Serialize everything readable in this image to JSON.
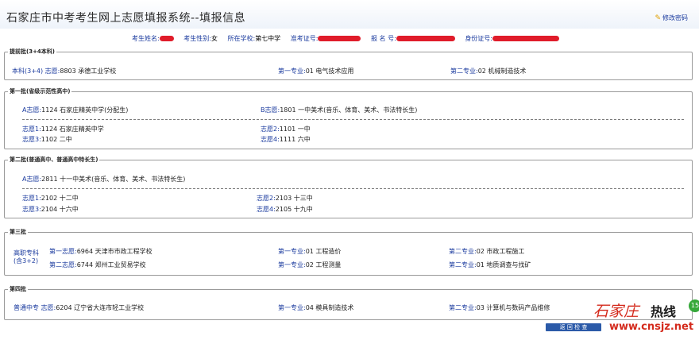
{
  "header": {
    "title": "石家庄市中考考生网上志愿填报系统--填报信息",
    "modify_password": "修改密码"
  },
  "student_info": {
    "name_label": "考生姓名:",
    "gender_label": "考生性别:",
    "gender_value": "女",
    "school_label": "所在学校:",
    "school_value": "第七中学",
    "exam_no_label": "准考证号:",
    "reg_no_label": "报 名 号:",
    "id_label": "身份证号:"
  },
  "sections": {
    "early": {
      "legend": "提前批(3+4本科)",
      "category": "本科(3+4)",
      "choice_label": "志愿:",
      "choice_value": "8803 承德工业学校",
      "major1_label": "第一专业:",
      "major1_value": "01 电气技术应用",
      "major2_label": "第二专业:",
      "major2_value": "02 机械制造技术"
    },
    "batch1": {
      "legend": "第一批(省级示范性高中)",
      "a_label": "A志愿:",
      "a_value": "1124 石家庄精英中学(分配生)",
      "b_label": "B志愿:",
      "b_value": "1801 一中美术(音乐、体育、美术、书法特长生)",
      "c1_label": "志愿1:",
      "c1_value": "1124 石家庄精英中学",
      "c2_label": "志愿2:",
      "c2_value": "1101 一中",
      "c3_label": "志愿3:",
      "c3_value": "1102 二中",
      "c4_label": "志愿4:",
      "c4_value": "1111 六中"
    },
    "batch2": {
      "legend": "第二批(普通高中、普通高中特长生)",
      "a_label": "A志愿:",
      "a_value": "2811 十一中美术(音乐、体育、美术、书法特长生)",
      "c1_label": "志愿1:",
      "c1_value": "2102 十二中",
      "c2_label": "志愿2:",
      "c2_value": "2103 十三中",
      "c3_label": "志愿3:",
      "c3_value": "2104 十六中",
      "c4_label": "志愿4:",
      "c4_value": "2105 十九中"
    },
    "batch3": {
      "legend": "第三批",
      "category_line1": "高职专科",
      "category_line2": "(含3+2)",
      "r1_choice_label": "第一志愿:",
      "r1_choice_value": "6964 天津市市政工程学校",
      "r1_m1_label": "第一专业:",
      "r1_m1_value": "01 工程造价",
      "r1_m2_label": "第二专业:",
      "r1_m2_value": "02 市政工程施工",
      "r2_choice_label": "第二志愿:",
      "r2_choice_value": "6744 郑州工业贸易学校",
      "r2_m1_label": "第一专业:",
      "r2_m1_value": "02 工程测量",
      "r2_m2_label": "第二专业:",
      "r2_m2_value": "01 地质调查与找矿"
    },
    "batch4": {
      "legend": "第四批",
      "category": "普通中专",
      "choice_label": "志愿:",
      "choice_value": "6204 辽宁省大连市轻工业学校",
      "major1_label": "第一专业:",
      "major1_value": "04 模具制造技术",
      "major2_label": "第二专业:",
      "major2_value": "03 计算机与数码产品维修"
    }
  },
  "footer": {
    "return_button": "返 回 检 查"
  },
  "watermark": {
    "brand_text": "石家庄",
    "hotline_text": "热线",
    "url": "www.cnsjz.net",
    "badge": "15"
  },
  "colors": {
    "label_blue": "#1a3a9e",
    "mask_red": "#e01c2a",
    "button_blue": "#2b5aa8"
  }
}
